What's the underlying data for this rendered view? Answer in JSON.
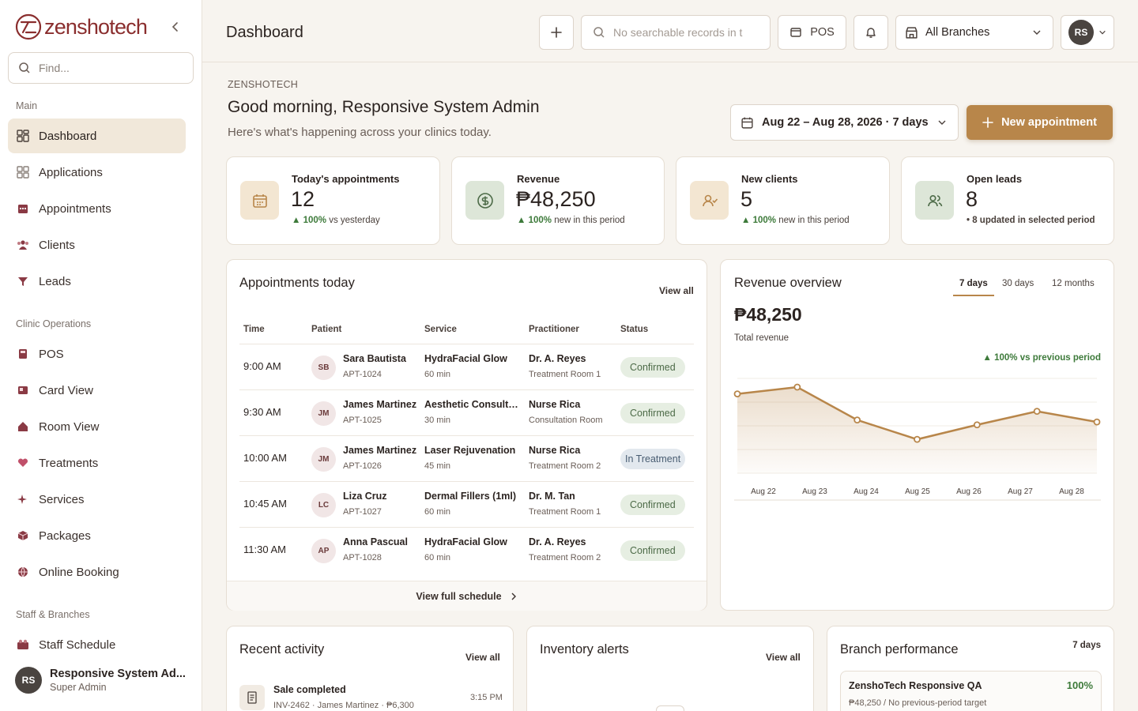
{
  "brand": {
    "name": "zenshotech"
  },
  "sidebar": {
    "search_placeholder": "Find...",
    "sections": {
      "main": "Main",
      "clinic": "Clinic Operations",
      "staff": "Staff & Branches"
    },
    "items": [
      {
        "label": "Dashboard",
        "icon": "grid-icon"
      },
      {
        "label": "Applications",
        "icon": "apps-icon"
      },
      {
        "label": "Appointments",
        "icon": "calendar-icon"
      },
      {
        "label": "Clients",
        "icon": "users-icon"
      },
      {
        "label": "Leads",
        "icon": "funnel-icon"
      },
      {
        "label": "POS",
        "icon": "pos-icon"
      },
      {
        "label": "Card View",
        "icon": "card-icon"
      },
      {
        "label": "Room View",
        "icon": "home-icon"
      },
      {
        "label": "Treatments",
        "icon": "heart-icon"
      },
      {
        "label": "Services",
        "icon": "sparkle-icon"
      },
      {
        "label": "Packages",
        "icon": "box-icon"
      },
      {
        "label": "Online Booking",
        "icon": "globe-icon"
      },
      {
        "label": "Staff Schedule",
        "icon": "staff-icon"
      }
    ],
    "user": {
      "initials": "RS",
      "name": "Responsive System Ad...",
      "role": "Super Admin"
    }
  },
  "topbar": {
    "title": "Dashboard",
    "search_placeholder": "No searchable records in t",
    "pos_label": "POS",
    "branch": "All Branches",
    "avatar_initials": "RS"
  },
  "header": {
    "crumb": "ZENSHOTECH",
    "greeting": "Good morning, Responsive System Admin",
    "subtitle": "Here's what's happening across your clinics today.",
    "date_range": "Aug 22 – Aug 28, 2026 · 7 days",
    "new_appointment": "New appointment"
  },
  "stats": [
    {
      "label": "Today's appointments",
      "value": "12",
      "delta": "▲ 100%",
      "note": " vs yesterday"
    },
    {
      "label": "Revenue",
      "value": "₱48,250",
      "delta": "▲ 100%",
      "note": " new in this period"
    },
    {
      "label": "New clients",
      "value": "5",
      "delta": "▲ 100%",
      "note": " new in this period"
    },
    {
      "label": "Open leads",
      "value": "8",
      "delta": "",
      "note": "• 8 updated in selected period"
    }
  ],
  "appointments": {
    "title": "Appointments today",
    "view_all": "View all",
    "columns": [
      "Time",
      "Patient",
      "Service",
      "Practitioner",
      "Status"
    ],
    "rows": [
      {
        "time": "9:00 AM",
        "initials": "SB",
        "patient": "Sara Bautista",
        "id": "APT-1024",
        "service": "HydraFacial Glow",
        "duration": "60 min",
        "practitioner": "Dr. A. Reyes",
        "room": "Treatment Room 1",
        "status": "Confirmed"
      },
      {
        "time": "9:30 AM",
        "initials": "JM",
        "patient": "James Martinez",
        "id": "APT-1025",
        "service": "Aesthetic Consultat...",
        "duration": "30 min",
        "practitioner": "Nurse Rica",
        "room": "Consultation Room",
        "status": "Confirmed"
      },
      {
        "time": "10:00 AM",
        "initials": "JM",
        "patient": "James Martinez",
        "id": "APT-1026",
        "service": "Laser Rejuvenation",
        "duration": "45 min",
        "practitioner": "Nurse Rica",
        "room": "Treatment Room 2",
        "status": "In Treatment"
      },
      {
        "time": "10:45 AM",
        "initials": "LC",
        "patient": "Liza Cruz",
        "id": "APT-1027",
        "service": "Dermal Fillers (1ml)",
        "duration": "60 min",
        "practitioner": "Dr. M. Tan",
        "room": "Treatment Room 1",
        "status": "Confirmed"
      },
      {
        "time": "11:30 AM",
        "initials": "AP",
        "patient": "Anna Pascual",
        "id": "APT-1028",
        "service": "HydraFacial Glow",
        "duration": "60 min",
        "practitioner": "Dr. A. Reyes",
        "room": "Treatment Room 2",
        "status": "Confirmed"
      }
    ],
    "footer": "View full schedule"
  },
  "revenue": {
    "title": "Revenue overview",
    "tabs": [
      "7 days",
      "30 days",
      "12 months"
    ],
    "total": "₱48,250",
    "total_label": "Total revenue",
    "delta": "▲ 100% vs previous period"
  },
  "chart_data": {
    "type": "area",
    "categories": [
      "Aug 22",
      "Aug 23",
      "Aug 24",
      "Aug 25",
      "Aug 26",
      "Aug 27",
      "Aug 28"
    ],
    "values": [
      8200,
      8900,
      5500,
      3500,
      5000,
      6400,
      5300
    ],
    "color": "#b8864a"
  },
  "activity": {
    "title": "Recent activity",
    "view_all": "View all",
    "item": {
      "title": "Sale completed",
      "detail": "INV-2462 · James Martinez · ₱6,300",
      "time": "3:15 PM"
    }
  },
  "inventory": {
    "title": "Inventory alerts",
    "view_all": "View all"
  },
  "branch": {
    "title": "Branch performance",
    "period": "7 days",
    "name": "ZenshoTech Responsive QA",
    "pct": "100%",
    "detail": "₱48,250 / No previous-period target"
  }
}
